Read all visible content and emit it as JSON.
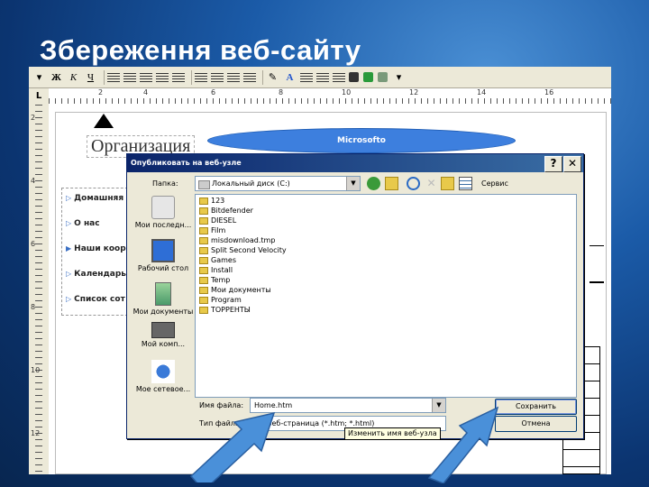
{
  "slide": {
    "title": "Збереження веб-сайту"
  },
  "word": {
    "toolbar": {
      "bold": "Ж",
      "italic": "К",
      "underline": "Ч"
    },
    "ruler": {
      "corner": "L",
      "top_marks": [
        "2",
        "4",
        "6",
        "8",
        "10",
        "12",
        "14",
        "16"
      ],
      "left_marks": [
        "2",
        "4",
        "6",
        "8",
        "10",
        "12"
      ]
    },
    "page": {
      "org_name": "Организация",
      "banner": "Microsofto",
      "nav": [
        "Домашняя",
        "О нас",
        "Наши коорд",
        "Календарь",
        "Список сот"
      ]
    }
  },
  "dialog": {
    "title": "Опубликовать на веб-узле",
    "help": "?",
    "close": "✕",
    "folder_label": "Папка:",
    "folder_value": "Локальный диск (C:)",
    "tools_label": "Сервис",
    "places": [
      "Мои последн...",
      "Рабочий стол",
      "Мои документы",
      "Мой комп...",
      "Мое сетевое..."
    ],
    "files": [
      "123",
      "Bitdefender",
      "DIESEL",
      "Film",
      "misdownload.tmp",
      "Split Second Velocity",
      "Games",
      "Install",
      "Temp",
      "Мои документы",
      "Program",
      "ТОРРЕНТЫ"
    ],
    "filename_label": "Имя файла:",
    "filename_value": "Home.htm",
    "filetype_label": "Тип файла:",
    "filetype_value": "Веб-страница (*.htm; *.html)",
    "save_button": "Сохранить",
    "cancel_button": "Отмена",
    "tooltip": "Изменить имя веб-узла"
  },
  "colors": {
    "accent": "#3d7fde",
    "titlebar": "#0a246a",
    "arrow": "#4a90d9"
  }
}
